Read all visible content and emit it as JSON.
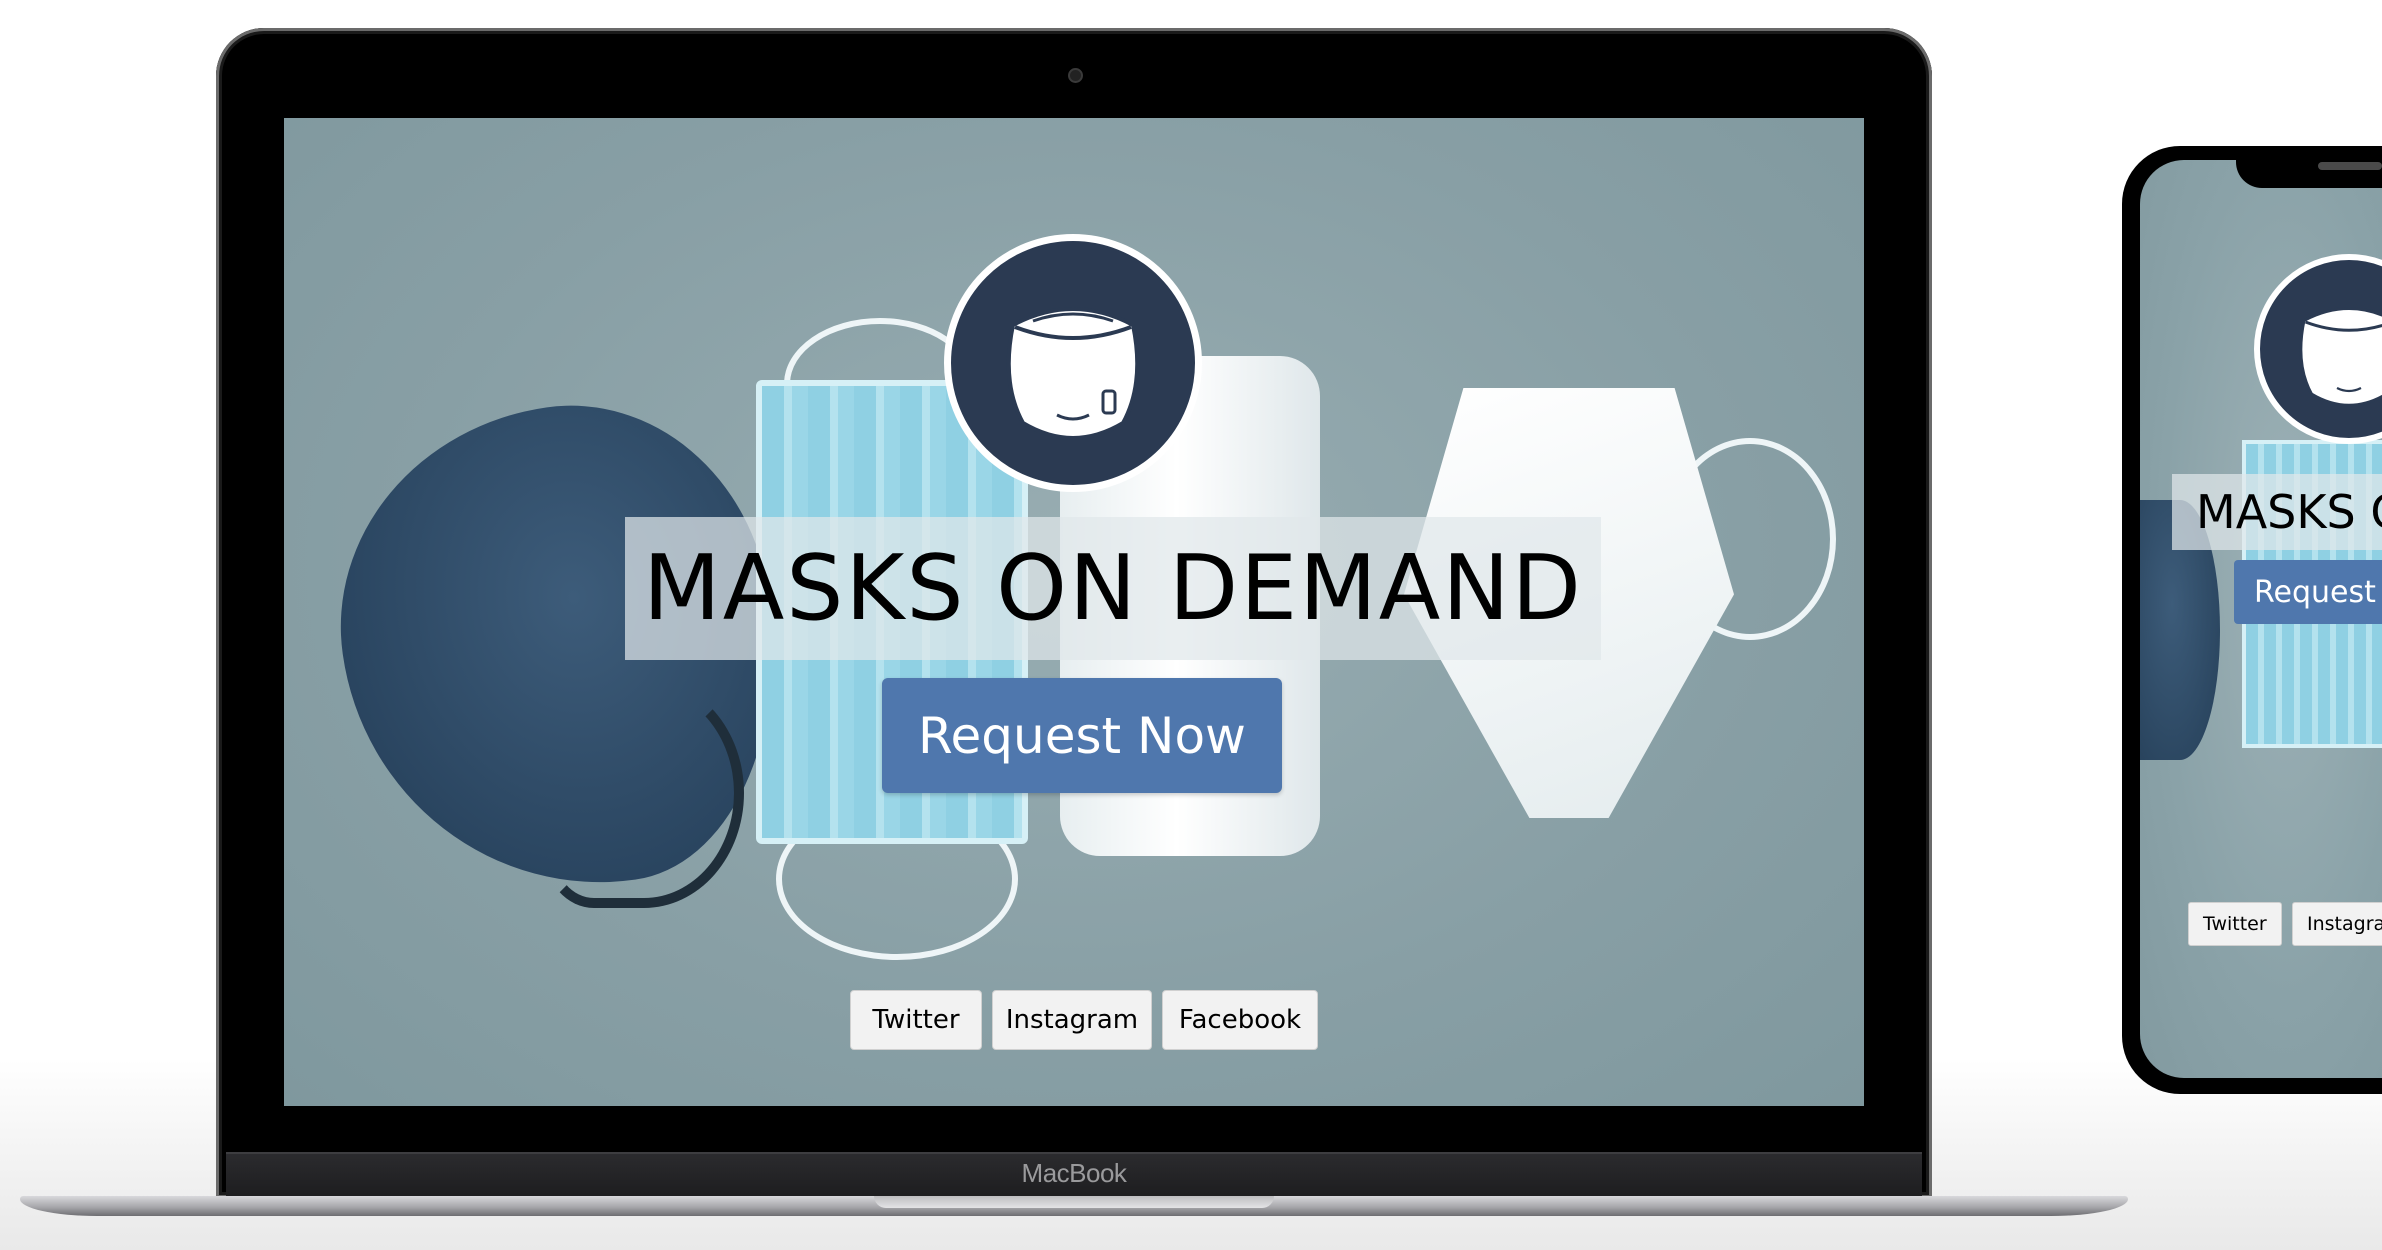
{
  "laptop": {
    "brand_label": "MacBook"
  },
  "site": {
    "title": "MASKS ON DEMAND",
    "cta_label": "Request Now",
    "logo_icon": "mask-icon",
    "social": [
      {
        "label": "Twitter"
      },
      {
        "label": "Instagram"
      },
      {
        "label": "Facebook"
      }
    ],
    "colors": {
      "logo_bg": "#2b3a52",
      "cta_bg": "#4f77ad",
      "background": "#889fa5"
    }
  },
  "phone": {
    "title": "MASKS O",
    "cta_label": "Request N",
    "social": [
      {
        "label": "Twitter"
      },
      {
        "label": "Instagram"
      }
    ]
  }
}
